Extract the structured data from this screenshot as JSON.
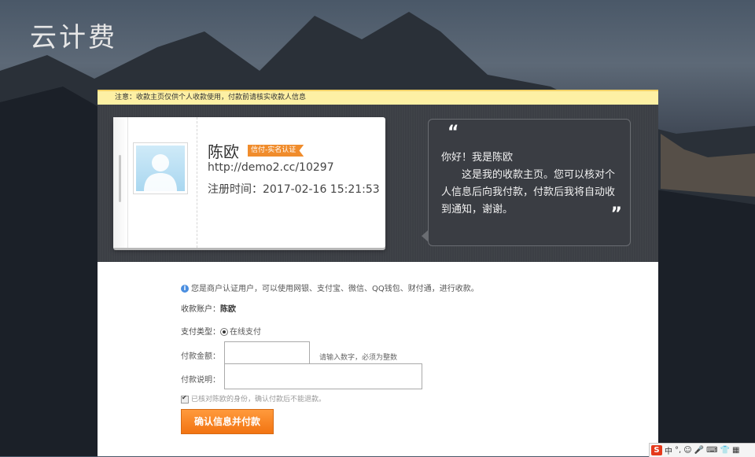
{
  "app": {
    "logo_text": "云计费"
  },
  "notice": {
    "text": "注意：收款主页仅供个人收款使用，付款前请核实收款人信息"
  },
  "profile": {
    "name": "陈欧",
    "badge": "信付-实名认证",
    "url": "http://demo2.cc/10297",
    "registered": "注册时间：2017-02-16 15:21:53"
  },
  "bubble": {
    "quote_open": "“",
    "quote_close": "”",
    "greeting": "你好！我是陈欧",
    "message": "这是我的收款主页。您可以核对个人信息后向我付款，付款后我将自动收到通知，谢谢。"
  },
  "form": {
    "info_text": "您是商户认证用户，可以使用网银、支付宝、微信、QQ钱包、财付通，进行收款。",
    "account_label": "收款账户：",
    "account_value": "陈欧",
    "paytype_label": "支付类型：",
    "paytype_option": "在线支付",
    "amount_label": "付款金额：",
    "amount_value": "",
    "amount_hint": "请输入数字，必须为整数",
    "note_label": "付款说明：",
    "note_value": "",
    "confirm_text": "已核对陈欧的身份，确认付款后不能退款。",
    "submit_label": "确认信息并付款"
  },
  "tray": {
    "ime_logo": "S",
    "ime_mode": "中",
    "punct": "°,",
    "items": [
      "☺",
      "🎤",
      "⌨",
      "👕",
      "▦"
    ]
  },
  "colors": {
    "accent": "#f27412",
    "notice_bg": "#fdf0a4",
    "header_band": "#3c3f45"
  }
}
